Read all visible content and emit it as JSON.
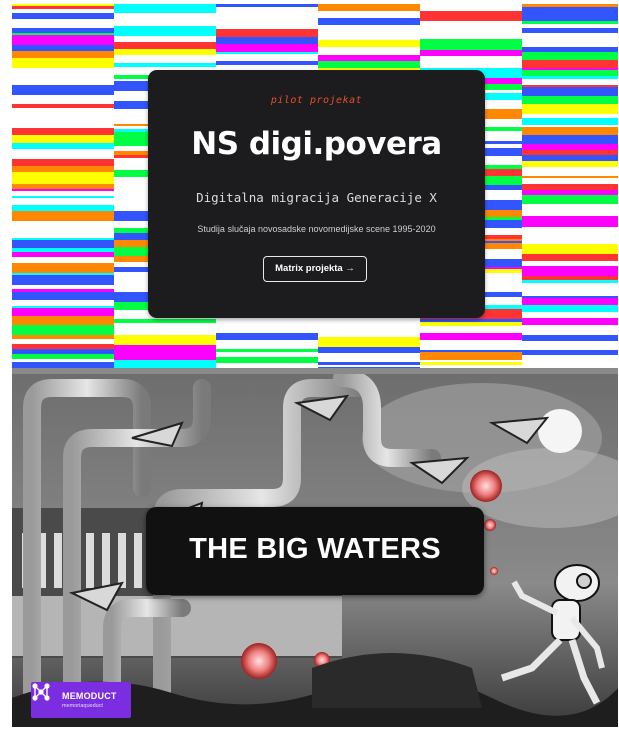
{
  "hero": {
    "eyebrow": "pilot projekat",
    "title": "NS digi.povera",
    "subtitle": "Digitalna migracija Generacije X",
    "description": "Studija slučaja novosadske novomedijske scene 1995-2020",
    "button_label": "Matrix projekta →"
  },
  "art_banner": {
    "title": "THE BIG WATERS"
  },
  "logo": {
    "name": "MEMODUCT",
    "tagline": "memoriaqueduct"
  },
  "colors": {
    "card_background": "#1c1c1e",
    "eyebrow_accent": "#e4502a",
    "logo_purple": "#7a2ee0",
    "glitch_palette": [
      "#ff00ff",
      "#00ffff",
      "#ffff00",
      "#00ff44",
      "#ff3333",
      "#3355ff",
      "#ffffff",
      "#ff8800"
    ]
  }
}
